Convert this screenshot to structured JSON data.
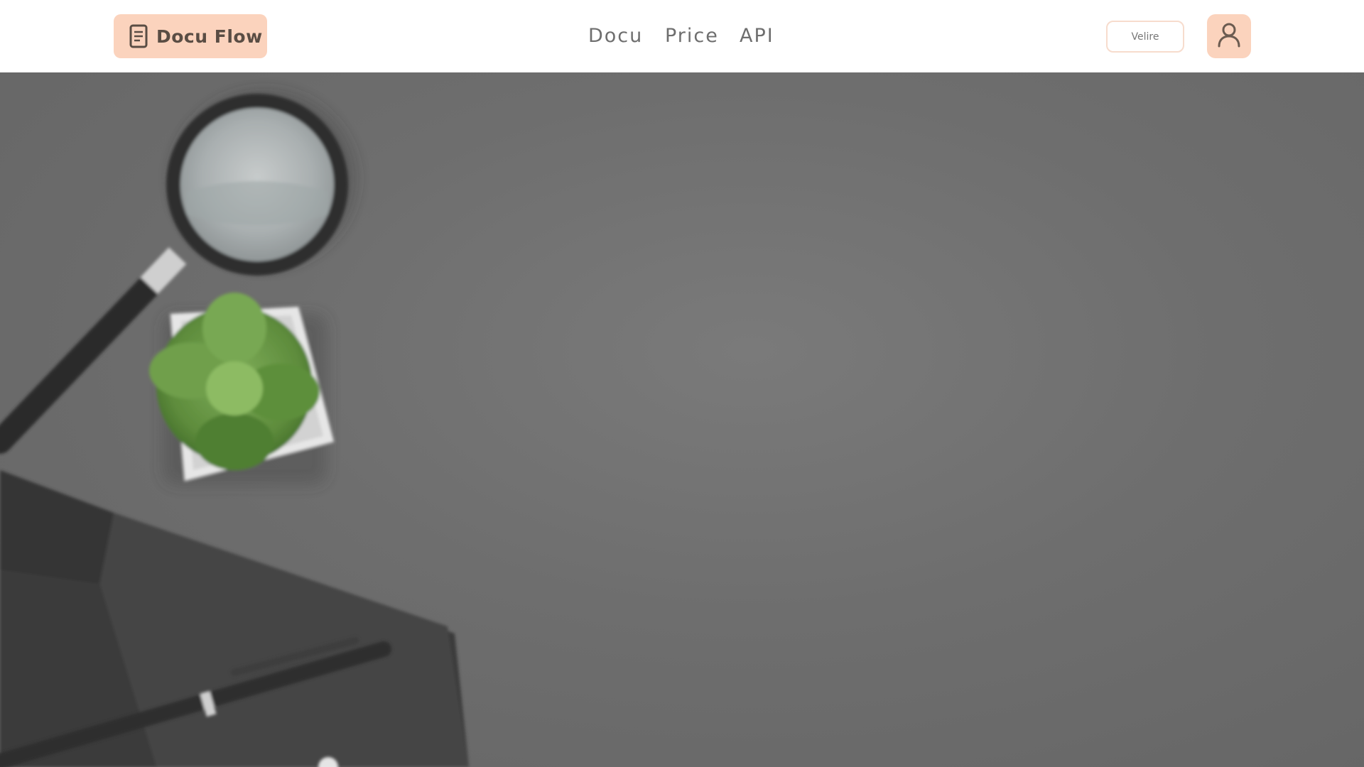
{
  "header": {
    "brand": {
      "name": "Docu Flow",
      "icon": "document-icon"
    },
    "nav": [
      {
        "label": "Docu"
      },
      {
        "label": "Price"
      },
      {
        "label": "API"
      }
    ],
    "pill_button": {
      "label": "Velire"
    },
    "avatar": {
      "icon": "user-icon"
    }
  },
  "hero": {
    "image": "desk-flatlay-image",
    "objects": [
      "magnifying-glass",
      "succulent-plant",
      "leather-notebook",
      "pen"
    ]
  },
  "colors": {
    "accent": "#fbd3bd",
    "accent_border": "#f7dccd",
    "hero_background": "#6e6e6e",
    "nav_text": "#6e6e6e",
    "header_background": "#ffffff"
  }
}
